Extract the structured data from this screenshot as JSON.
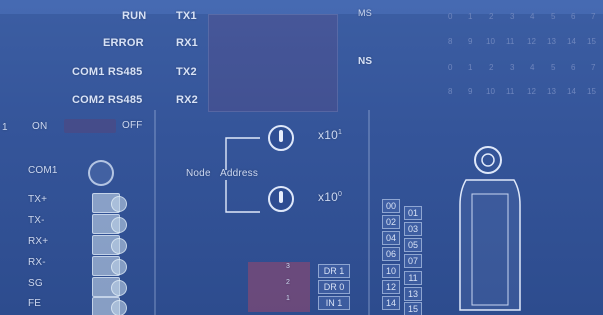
{
  "indicators": {
    "run": "RUN",
    "error": "ERROR",
    "com1_rs485": "COM1 RS485",
    "com2_rs485": "COM2 RS485",
    "tx1": "TX1",
    "rx1": "RX1",
    "tx2": "TX2",
    "rx2": "RX2",
    "ms": "MS",
    "ns": "NS"
  },
  "switch": {
    "on": "ON",
    "off": "OFF",
    "one": "1"
  },
  "terminal": {
    "com1": "COM1",
    "labels": [
      "TX+",
      "TX-",
      "RX+",
      "RX-",
      "SG",
      "FE"
    ]
  },
  "node_address": {
    "node": "Node",
    "address": "Address",
    "x10_1": "x10",
    "exp1": "1",
    "x10_0": "x10",
    "exp0": "0"
  },
  "dip_labels": [
    "DR 1",
    "DR 0",
    "IN 1"
  ],
  "dip_numbers": [
    "3",
    "2",
    "1"
  ],
  "status_grid_rows": [
    [
      "0",
      "1",
      "2",
      "3",
      "4",
      "5",
      "6",
      "7"
    ],
    [
      "8",
      "9",
      "10",
      "11",
      "12",
      "13",
      "14",
      "15"
    ],
    [
      "0",
      "1",
      "2",
      "3",
      "4",
      "5",
      "6",
      "7"
    ],
    [
      "8",
      "9",
      "10",
      "11",
      "12",
      "13",
      "14",
      "15"
    ]
  ],
  "chip_grid": {
    "left": [
      "00",
      "02",
      "04",
      "06",
      "10",
      "12",
      "14"
    ],
    "right": [
      "01",
      "03",
      "05",
      "07",
      "11",
      "13",
      "15"
    ]
  }
}
